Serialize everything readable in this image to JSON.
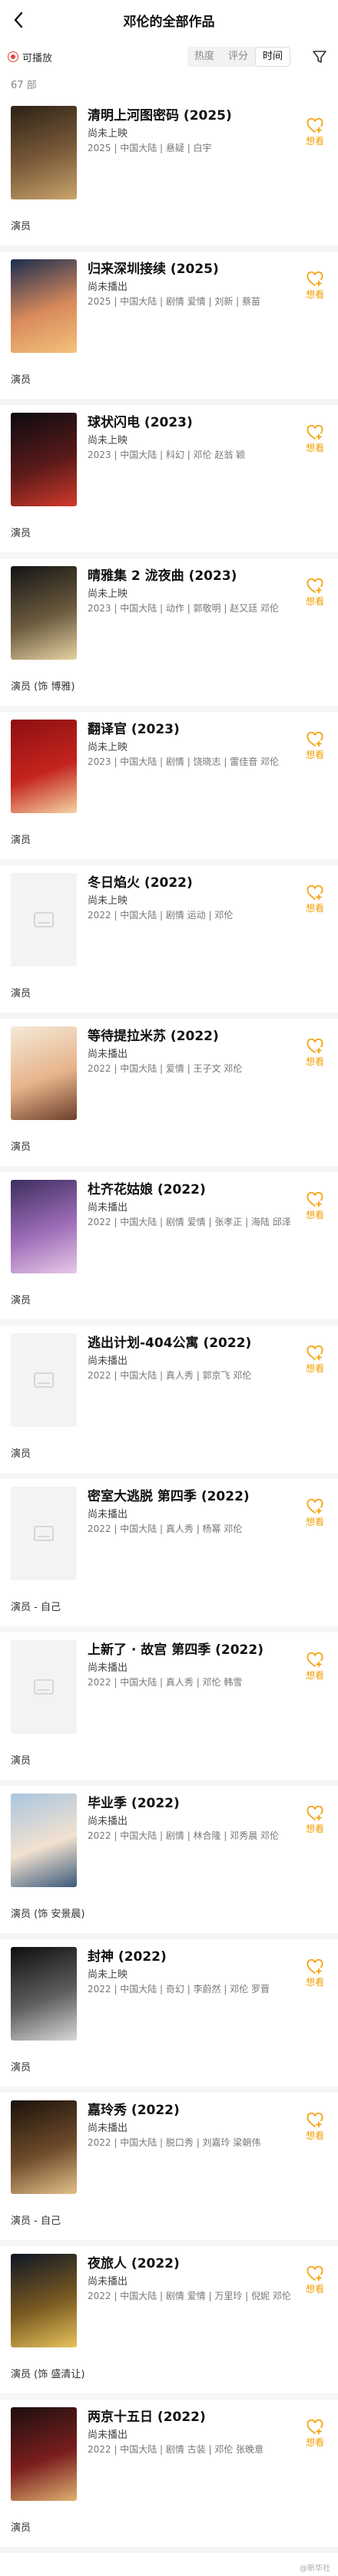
{
  "header": {
    "title": "邓伦的全部作品"
  },
  "filters": {
    "playable": "可播放",
    "sort": [
      "热度",
      "评分",
      "时间"
    ],
    "active_sort": 2
  },
  "count": "67 部",
  "want_label": "想看",
  "items": [
    {
      "title": "清明上河图密码 (2025)",
      "status": "尚未上映",
      "meta": "2025 | 中国大陆 | 悬疑 | 白宇",
      "role": "演员",
      "poster": [
        "#2b2116",
        "#7c5c3a",
        "#c9a46c"
      ],
      "has_poster": true
    },
    {
      "title": "归来深圳接续 (2025)",
      "status": "尚未播出",
      "meta": "2025 | 中国大陆 | 剧情 爱情 | 刘新 | 蔡苗",
      "role": "演员",
      "poster": [
        "#1b2d4f",
        "#d98a5c",
        "#f3c27a"
      ],
      "has_poster": true
    },
    {
      "title": "球状闪电 (2023)",
      "status": "尚未上映",
      "meta": "2023 | 中国大陆 | 科幻 | 邓伦 赵翁 颖",
      "role": "演员",
      "poster": [
        "#0b0b0f",
        "#5a1a1a",
        "#d13a2a"
      ],
      "has_poster": true
    },
    {
      "title": "晴雅集 2 泷夜曲 (2023)",
      "status": "尚未上映",
      "meta": "2023 | 中国大陆 | 动作 | 郭敬明 | 赵又廷 邓伦",
      "role": "演员 (饰 博雅)",
      "poster": [
        "#141414",
        "#6b5a3e",
        "#e6d3a3"
      ],
      "has_poster": true
    },
    {
      "title": "翻译官 (2023)",
      "status": "尚未上映",
      "meta": "2023 | 中国大陆 | 剧情 | 饶晓志 | 雷佳音 邓伦",
      "role": "演员",
      "poster": [
        "#8c0f12",
        "#c4241d",
        "#f4d4a2"
      ],
      "has_poster": true
    },
    {
      "title": "冬日焰火 (2022)",
      "status": "尚未上映",
      "meta": "2022 | 中国大陆 | 剧情 运动 | 邓伦",
      "role": "演员",
      "poster": [],
      "has_poster": false
    },
    {
      "title": "等待提拉米苏 (2022)",
      "status": "尚未播出",
      "meta": "2022 | 中国大陆 | 爱情 | 王子文 邓伦",
      "role": "演员",
      "poster": [
        "#f4ead8",
        "#e6b38a",
        "#6d3f2b"
      ],
      "has_poster": true
    },
    {
      "title": "杜齐花姑娘 (2022)",
      "status": "尚未播出",
      "meta": "2022 | 中国大陆 | 剧情 爱情 | 张孝正 | 海陆 邱泽",
      "role": "演员",
      "poster": [
        "#3c2e5e",
        "#9e6db8",
        "#e7c9e8"
      ],
      "has_poster": true
    },
    {
      "title": "逃出计划-404公寓 (2022)",
      "status": "尚未播出",
      "meta": "2022 | 中国大陆 | 真人秀 | 郭京飞 邓伦",
      "role": "演员",
      "poster": [],
      "has_poster": false
    },
    {
      "title": "密室大逃脱 第四季 (2022)",
      "status": "尚未播出",
      "meta": "2022 | 中国大陆 | 真人秀 | 杨幂 邓伦",
      "role": "演员 - 自己",
      "poster": [],
      "has_poster": false
    },
    {
      "title": "上新了 · 故宫 第四季 (2022)",
      "status": "尚未播出",
      "meta": "2022 | 中国大陆 | 真人秀 | 邓伦 韩雪",
      "role": "演员",
      "poster": [],
      "has_poster": false
    },
    {
      "title": "毕业季 (2022)",
      "status": "尚未播出",
      "meta": "2022 | 中国大陆 | 剧情 | 林合隆 | 邓秀晨 邓伦",
      "role": "演员 (饰 安景晨)",
      "poster": [
        "#a9c6e0",
        "#f2e1d0",
        "#3b5a7a"
      ],
      "has_poster": true
    },
    {
      "title": "封神 (2022)",
      "status": "尚未上映",
      "meta": "2022 | 中国大陆 | 奇幻 | 李蔚然 | 邓伦 罗晋",
      "role": "演员",
      "poster": [
        "#0e0e0e",
        "#5e5e5e",
        "#d8d8d8"
      ],
      "has_poster": true
    },
    {
      "title": "嘉玲秀 (2022)",
      "status": "尚未播出",
      "meta": "2022 | 中国大陆 | 脱口秀 | 刘嘉玲 梁朝伟",
      "role": "演员 - 自己",
      "poster": [
        "#1a120c",
        "#6e4b2a",
        "#e4c08a"
      ],
      "has_poster": true
    },
    {
      "title": "夜旅人 (2022)",
      "status": "尚未播出",
      "meta": "2022 | 中国大陆 | 剧情 爱情 | 万里玲 | 倪妮 邓伦",
      "role": "演员 (饰 盛清让)",
      "poster": [
        "#0d1624",
        "#7a5a22",
        "#e7c25a"
      ],
      "has_poster": true
    },
    {
      "title": "两京十五日 (2022)",
      "status": "尚未播出",
      "meta": "2022 | 中国大陆 | 剧情 古装 | 邓伦 张晚意",
      "role": "演员",
      "poster": [
        "#1c0f0f",
        "#7a1e1e",
        "#e0b070"
      ],
      "has_poster": true
    }
  ],
  "footer": "@新华社"
}
